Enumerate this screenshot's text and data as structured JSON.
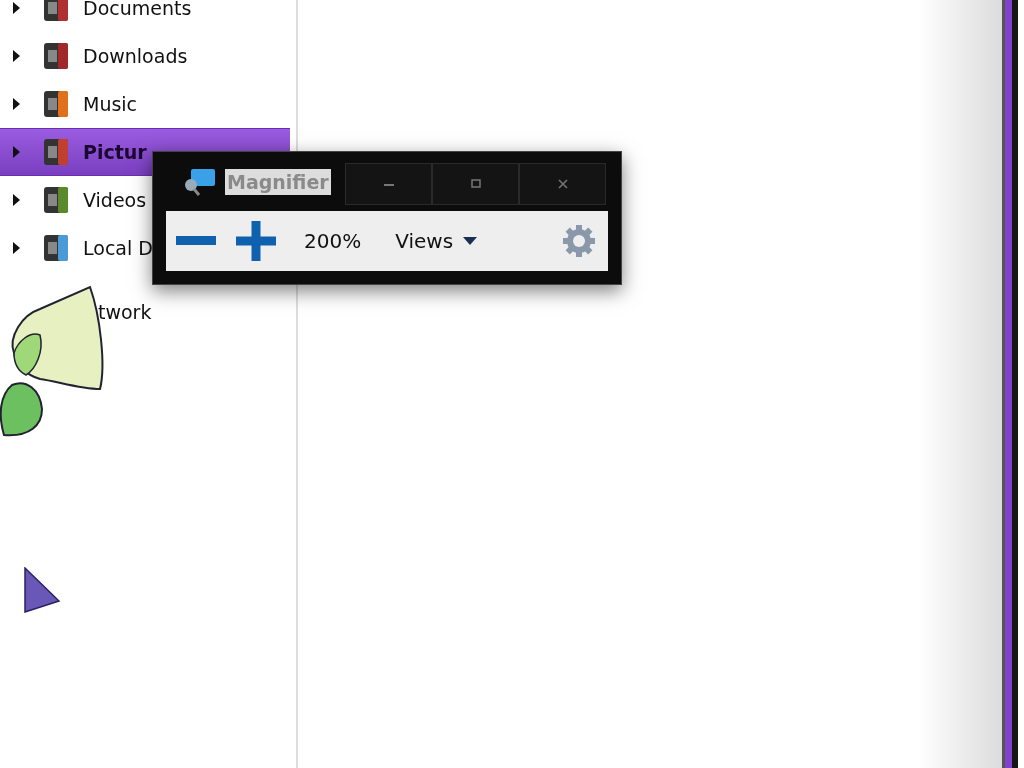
{
  "navigation": {
    "items": [
      {
        "label": "Documents",
        "selected": false,
        "color": "#b03030"
      },
      {
        "label": "Downloads",
        "selected": false,
        "color": "#a02828"
      },
      {
        "label": "Music",
        "selected": false,
        "color": "#e0701a"
      },
      {
        "label": "Pictur",
        "selected": true,
        "color": "#c04030"
      },
      {
        "label": "Videos",
        "selected": false,
        "color": "#5a8a2a"
      },
      {
        "label": "Local D",
        "selected": false,
        "color": "#4a9ad8"
      }
    ],
    "network": {
      "label": "twork"
    }
  },
  "magnifier": {
    "title": "Magnifier",
    "zoom": "200%",
    "views": "Views"
  }
}
